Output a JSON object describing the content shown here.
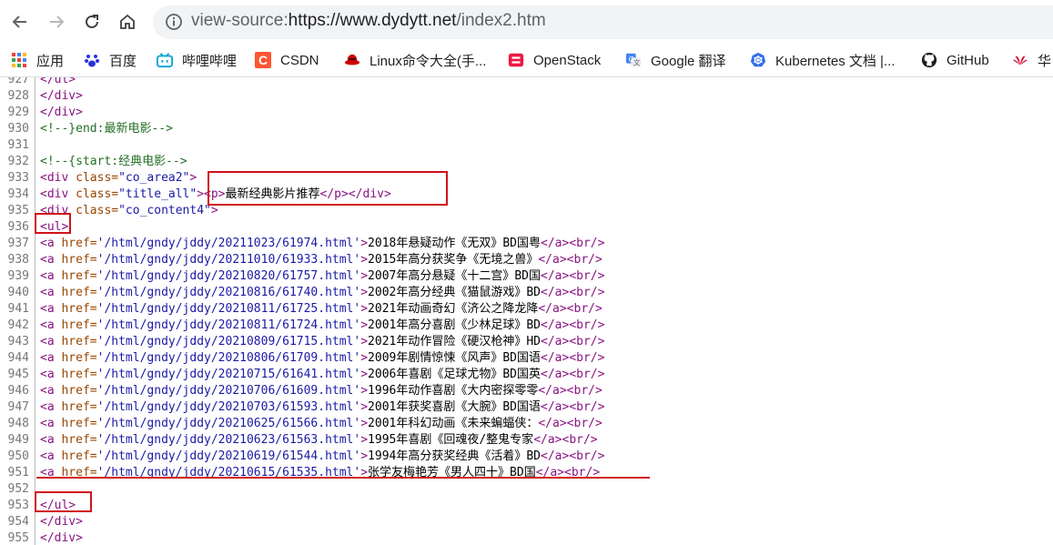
{
  "browser": {
    "url_prefix": "view-source:",
    "url_host": "https://www.dydytt.net",
    "url_path": "/index2.htm"
  },
  "bookmarks": [
    {
      "label": "应用",
      "icon": "apps-grid-icon"
    },
    {
      "label": "百度",
      "icon": "baidu-paw-icon"
    },
    {
      "label": "哔哩哔哩",
      "icon": "bilibili-tv-icon"
    },
    {
      "label": "CSDN",
      "icon": "csdn-logo-icon"
    },
    {
      "label": "Linux命令大全(手...",
      "icon": "redhat-icon"
    },
    {
      "label": "OpenStack",
      "icon": "openstack-logo-icon"
    },
    {
      "label": "Google 翻译",
      "icon": "google-translate-icon"
    },
    {
      "label": "Kubernetes 文档 |...",
      "icon": "kubernetes-helm-icon"
    },
    {
      "label": "GitHub",
      "icon": "github-octocat-icon"
    },
    {
      "label": "华",
      "icon": "huawei-logo-icon"
    }
  ],
  "source_lines": [
    {
      "n": "927",
      "parts": [
        [
          "tag",
          "</ul>"
        ]
      ]
    },
    {
      "n": "928",
      "parts": [
        [
          "tag",
          "</div>"
        ]
      ]
    },
    {
      "n": "929",
      "parts": [
        [
          "tag",
          "</div>"
        ]
      ]
    },
    {
      "n": "930",
      "parts": [
        [
          "cmt",
          "<!--}end:最新电影-->"
        ]
      ]
    },
    {
      "n": "931",
      "parts": []
    },
    {
      "n": "932",
      "parts": [
        [
          "cmt",
          "<!--{start:经典电影-->"
        ]
      ]
    },
    {
      "n": "933",
      "parts": [
        [
          "tag",
          "<div "
        ],
        [
          "attr",
          "class="
        ],
        [
          "val",
          "\"co_area2\""
        ],
        [
          "tag",
          ">"
        ]
      ]
    },
    {
      "n": "934",
      "parts": [
        [
          "tag",
          "<div "
        ],
        [
          "attr",
          "class="
        ],
        [
          "val",
          "\"title_all\""
        ],
        [
          "tag",
          ">"
        ],
        [
          "tag",
          "<p>"
        ],
        [
          "txt",
          "最新经典影片推荐"
        ],
        [
          "tag",
          "</p>"
        ],
        [
          "tag",
          "</div>"
        ]
      ]
    },
    {
      "n": "935",
      "parts": [
        [
          "tag",
          "<div "
        ],
        [
          "attr",
          "class="
        ],
        [
          "val",
          "\"co_content4\""
        ],
        [
          "tag",
          ">"
        ]
      ]
    },
    {
      "n": "936",
      "parts": [
        [
          "tag",
          "<ul>"
        ]
      ]
    },
    {
      "n": "937",
      "parts": [
        [
          "tag",
          "<a "
        ],
        [
          "attr",
          "href="
        ],
        [
          "val",
          "'/html/gndy/jddy/20211023/61974.html'"
        ],
        [
          "tag",
          ">"
        ],
        [
          "txt",
          "2018年悬疑动作《无双》BD国粤"
        ],
        [
          "tag",
          "</a>"
        ],
        [
          "tag",
          "<br/>"
        ]
      ]
    },
    {
      "n": "938",
      "parts": [
        [
          "tag",
          "<a "
        ],
        [
          "attr",
          "href="
        ],
        [
          "val",
          "'/html/gndy/jddy/20211010/61933.html'"
        ],
        [
          "tag",
          ">"
        ],
        [
          "txt",
          "2015年高分获奖争《无境之兽》"
        ],
        [
          "tag",
          "</a>"
        ],
        [
          "tag",
          "<br/>"
        ]
      ]
    },
    {
      "n": "939",
      "parts": [
        [
          "tag",
          "<a "
        ],
        [
          "attr",
          "href="
        ],
        [
          "val",
          "'/html/gndy/jddy/20210820/61757.html'"
        ],
        [
          "tag",
          ">"
        ],
        [
          "txt",
          "2007年高分悬疑《十二宫》BD国"
        ],
        [
          "tag",
          "</a>"
        ],
        [
          "tag",
          "<br/>"
        ]
      ]
    },
    {
      "n": "940",
      "parts": [
        [
          "tag",
          "<a "
        ],
        [
          "attr",
          "href="
        ],
        [
          "val",
          "'/html/gndy/jddy/20210816/61740.html'"
        ],
        [
          "tag",
          ">"
        ],
        [
          "txt",
          "2002年高分经典《猫鼠游戏》BD"
        ],
        [
          "tag",
          "</a>"
        ],
        [
          "tag",
          "<br/>"
        ]
      ]
    },
    {
      "n": "941",
      "parts": [
        [
          "tag",
          "<a "
        ],
        [
          "attr",
          "href="
        ],
        [
          "val",
          "'/html/gndy/jddy/20210811/61725.html'"
        ],
        [
          "tag",
          ">"
        ],
        [
          "txt",
          "2021年动画奇幻《济公之降龙降"
        ],
        [
          "tag",
          "</a>"
        ],
        [
          "tag",
          "<br/>"
        ]
      ]
    },
    {
      "n": "942",
      "parts": [
        [
          "tag",
          "<a "
        ],
        [
          "attr",
          "href="
        ],
        [
          "val",
          "'/html/gndy/jddy/20210811/61724.html'"
        ],
        [
          "tag",
          ">"
        ],
        [
          "txt",
          "2001年高分喜剧《少林足球》BD"
        ],
        [
          "tag",
          "</a>"
        ],
        [
          "tag",
          "<br/>"
        ]
      ]
    },
    {
      "n": "943",
      "parts": [
        [
          "tag",
          "<a "
        ],
        [
          "attr",
          "href="
        ],
        [
          "val",
          "'/html/gndy/jddy/20210809/61715.html'"
        ],
        [
          "tag",
          ">"
        ],
        [
          "txt",
          "2021年动作冒险《硬汉枪神》HD"
        ],
        [
          "tag",
          "</a>"
        ],
        [
          "tag",
          "<br/>"
        ]
      ]
    },
    {
      "n": "944",
      "parts": [
        [
          "tag",
          "<a "
        ],
        [
          "attr",
          "href="
        ],
        [
          "val",
          "'/html/gndy/jddy/20210806/61709.html'"
        ],
        [
          "tag",
          ">"
        ],
        [
          "txt",
          "2009年剧情惊悚《风声》BD国语"
        ],
        [
          "tag",
          "</a>"
        ],
        [
          "tag",
          "<br/>"
        ]
      ]
    },
    {
      "n": "945",
      "parts": [
        [
          "tag",
          "<a "
        ],
        [
          "attr",
          "href="
        ],
        [
          "val",
          "'/html/gndy/jddy/20210715/61641.html'"
        ],
        [
          "tag",
          ">"
        ],
        [
          "txt",
          "2006年喜剧《足球尤物》BD国英"
        ],
        [
          "tag",
          "</a>"
        ],
        [
          "tag",
          "<br/>"
        ]
      ]
    },
    {
      "n": "946",
      "parts": [
        [
          "tag",
          "<a "
        ],
        [
          "attr",
          "href="
        ],
        [
          "val",
          "'/html/gndy/jddy/20210706/61609.html'"
        ],
        [
          "tag",
          ">"
        ],
        [
          "txt",
          "1996年动作喜剧《大内密探零零"
        ],
        [
          "tag",
          "</a>"
        ],
        [
          "tag",
          "<br/>"
        ]
      ]
    },
    {
      "n": "947",
      "parts": [
        [
          "tag",
          "<a "
        ],
        [
          "attr",
          "href="
        ],
        [
          "val",
          "'/html/gndy/jddy/20210703/61593.html'"
        ],
        [
          "tag",
          ">"
        ],
        [
          "txt",
          "2001年获奖喜剧《大腕》BD国语"
        ],
        [
          "tag",
          "</a>"
        ],
        [
          "tag",
          "<br/>"
        ]
      ]
    },
    {
      "n": "948",
      "parts": [
        [
          "tag",
          "<a "
        ],
        [
          "attr",
          "href="
        ],
        [
          "val",
          "'/html/gndy/jddy/20210625/61566.html'"
        ],
        [
          "tag",
          ">"
        ],
        [
          "txt",
          "2001年科幻动画《未来蝙蝠侠："
        ],
        [
          "tag",
          "</a>"
        ],
        [
          "tag",
          "<br/>"
        ]
      ]
    },
    {
      "n": "949",
      "parts": [
        [
          "tag",
          "<a "
        ],
        [
          "attr",
          "href="
        ],
        [
          "val",
          "'/html/gndy/jddy/20210623/61563.html'"
        ],
        [
          "tag",
          ">"
        ],
        [
          "txt",
          "1995年喜剧《回魂夜/整鬼专家"
        ],
        [
          "tag",
          "</a>"
        ],
        [
          "tag",
          "<br/>"
        ]
      ]
    },
    {
      "n": "950",
      "parts": [
        [
          "tag",
          "<a "
        ],
        [
          "attr",
          "href="
        ],
        [
          "val",
          "'/html/gndy/jddy/20210619/61544.html'"
        ],
        [
          "tag",
          ">"
        ],
        [
          "txt",
          "1994年高分获奖经典《活着》BD"
        ],
        [
          "tag",
          "</a>"
        ],
        [
          "tag",
          "<br/>"
        ]
      ]
    },
    {
      "n": "951",
      "parts": [
        [
          "tag",
          "<a "
        ],
        [
          "attr",
          "href="
        ],
        [
          "val",
          "'/html/gndy/jddy/20210615/61535.html'"
        ],
        [
          "tag",
          ">"
        ],
        [
          "txt",
          "张学友梅艳芳《男人四十》BD国"
        ],
        [
          "tag",
          "</a>"
        ],
        [
          "tag",
          "<br/>"
        ]
      ]
    },
    {
      "n": "952",
      "parts": []
    },
    {
      "n": "953",
      "parts": [
        [
          "tag",
          "</ul>"
        ]
      ]
    },
    {
      "n": "954",
      "parts": [
        [
          "tag",
          "</div>"
        ]
      ]
    },
    {
      "n": "955",
      "parts": [
        [
          "tag",
          "</div>"
        ]
      ]
    }
  ],
  "colors": {
    "tag": "#881280",
    "attr": "#994500",
    "value": "#1a1aa6",
    "comment": "#236e25",
    "annotation": "#d0121b"
  }
}
